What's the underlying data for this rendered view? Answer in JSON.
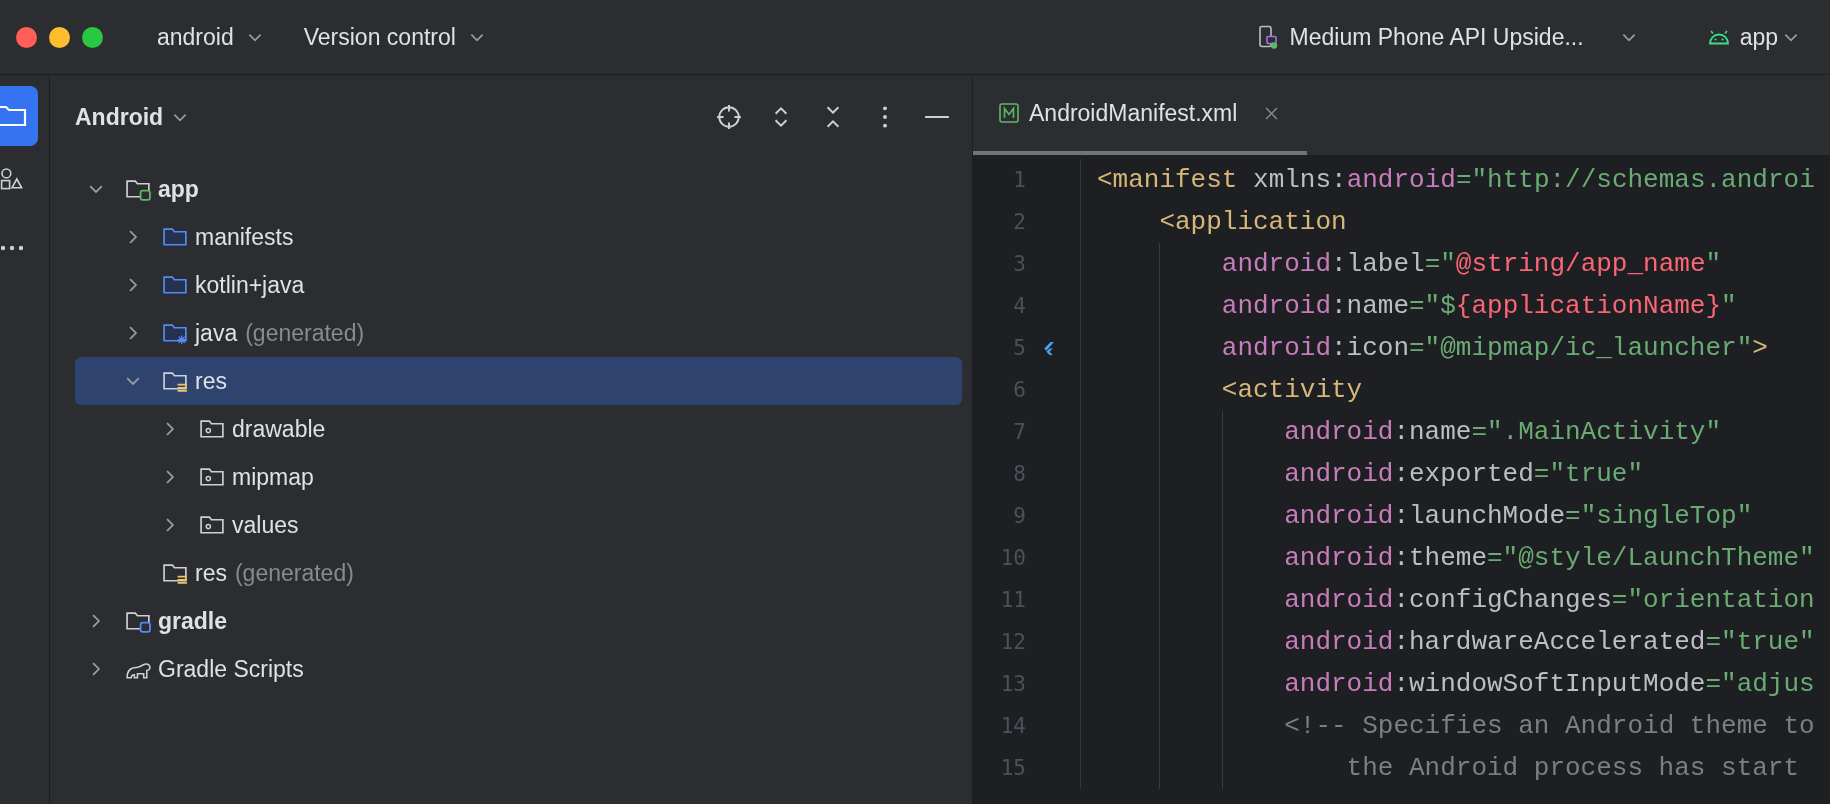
{
  "title_bar": {
    "project": "android",
    "vcs": "Version control",
    "device": "Medium Phone API Upside...",
    "run_config": "app"
  },
  "project_panel": {
    "title": "Android",
    "tree": [
      {
        "label": "app",
        "kind": "module",
        "expanded": true,
        "selected": false,
        "children": [
          {
            "label": "manifests",
            "kind": "folder",
            "expanded": false,
            "selected": false
          },
          {
            "label": "kotlin+java",
            "kind": "folder",
            "expanded": false,
            "selected": false
          },
          {
            "label": "java",
            "note": "(generated)",
            "kind": "generated",
            "expanded": false,
            "selected": false
          },
          {
            "label": "res",
            "kind": "res",
            "expanded": true,
            "selected": true,
            "children": [
              {
                "label": "drawable",
                "kind": "resdir",
                "expanded": false,
                "selected": false
              },
              {
                "label": "mipmap",
                "kind": "resdir",
                "expanded": false,
                "selected": false
              },
              {
                "label": "values",
                "kind": "resdir",
                "expanded": false,
                "selected": false
              }
            ]
          },
          {
            "label": "res",
            "note": "(generated)",
            "kind": "res",
            "selected": false
          }
        ]
      },
      {
        "label": "gradle",
        "kind": "gradle-module",
        "expanded": false,
        "selected": false
      },
      {
        "label": "Gradle Scripts",
        "kind": "scripts",
        "expanded": false,
        "selected": false
      }
    ]
  },
  "editor": {
    "tabs": [
      {
        "label": "AndroidManifest.xml",
        "selected": true
      }
    ],
    "lines": [
      {
        "number": "1",
        "marker": false,
        "tokens": [
          {
            "kind": "tag",
            "text": "<manifest "
          },
          {
            "kind": "plain",
            "text": "xmlns:"
          },
          {
            "kind": "ns",
            "text": "android"
          },
          {
            "kind": "str",
            "text": "=\"http://schemas.androi"
          }
        ],
        "children": [
          {
            "number": "2",
            "marker": false,
            "tokens": [
              {
                "kind": "tag",
                "text": "<application"
              }
            ],
            "children": [
              {
                "number": "3",
                "marker": false,
                "tokens": [
                  {
                    "kind": "ns",
                    "text": "android"
                  },
                  {
                    "kind": "plain",
                    "text": ":label"
                  },
                  {
                    "kind": "str",
                    "text": "=\""
                  },
                  {
                    "kind": "ref",
                    "text": "@string/app_name"
                  },
                  {
                    "kind": "str",
                    "text": "\""
                  }
                ]
              },
              {
                "number": "4",
                "marker": false,
                "tokens": [
                  {
                    "kind": "ns",
                    "text": "android"
                  },
                  {
                    "kind": "plain",
                    "text": ":name"
                  },
                  {
                    "kind": "str",
                    "text": "=\"$"
                  },
                  {
                    "kind": "ref",
                    "text": "{applicationName}"
                  },
                  {
                    "kind": "str",
                    "text": "\""
                  }
                ]
              },
              {
                "number": "5",
                "marker": true,
                "tokens": [
                  {
                    "kind": "ns",
                    "text": "android"
                  },
                  {
                    "kind": "plain",
                    "text": ":icon"
                  },
                  {
                    "kind": "str",
                    "text": "=\"@mipmap/ic_launcher\""
                  },
                  {
                    "kind": "tag",
                    "text": ">"
                  }
                ]
              },
              {
                "number": "6",
                "marker": false,
                "tokens": [
                  {
                    "kind": "tag",
                    "text": "<activity"
                  }
                ],
                "children": [
                  {
                    "number": "7",
                    "marker": false,
                    "tokens": [
                      {
                        "kind": "ns",
                        "text": "android"
                      },
                      {
                        "kind": "plain",
                        "text": ":name"
                      },
                      {
                        "kind": "str",
                        "text": "=\".MainActivity\""
                      }
                    ]
                  },
                  {
                    "number": "8",
                    "marker": false,
                    "tokens": [
                      {
                        "kind": "ns",
                        "text": "android"
                      },
                      {
                        "kind": "plain",
                        "text": ":exported"
                      },
                      {
                        "kind": "str",
                        "text": "=\"true\""
                      }
                    ]
                  },
                  {
                    "number": "9",
                    "marker": false,
                    "tokens": [
                      {
                        "kind": "ns",
                        "text": "android"
                      },
                      {
                        "kind": "plain",
                        "text": ":launchMode"
                      },
                      {
                        "kind": "str",
                        "text": "=\"singleTop\""
                      }
                    ]
                  },
                  {
                    "number": "10",
                    "marker": false,
                    "tokens": [
                      {
                        "kind": "ns",
                        "text": "android"
                      },
                      {
                        "kind": "plain",
                        "text": ":theme"
                      },
                      {
                        "kind": "str",
                        "text": "=\"@style/LaunchTheme\""
                      }
                    ]
                  },
                  {
                    "number": "11",
                    "marker": false,
                    "tokens": [
                      {
                        "kind": "ns",
                        "text": "android"
                      },
                      {
                        "kind": "plain",
                        "text": ":configChanges"
                      },
                      {
                        "kind": "str",
                        "text": "=\"orientation"
                      }
                    ]
                  },
                  {
                    "number": "12",
                    "marker": false,
                    "tokens": [
                      {
                        "kind": "ns",
                        "text": "android"
                      },
                      {
                        "kind": "plain",
                        "text": ":hardwareAccelerated"
                      },
                      {
                        "kind": "str",
                        "text": "=\"true\""
                      }
                    ]
                  },
                  {
                    "number": "13",
                    "marker": false,
                    "tokens": [
                      {
                        "kind": "ns",
                        "text": "android"
                      },
                      {
                        "kind": "plain",
                        "text": ":windowSoftInputMode"
                      },
                      {
                        "kind": "str",
                        "text": "=\"adjus"
                      }
                    ]
                  },
                  {
                    "number": "14",
                    "marker": false,
                    "tokens": [
                      {
                        "kind": "comment",
                        "text": "<!-- Specifies an Android theme to"
                      }
                    ],
                    "children": [
                      {
                        "number": "15",
                        "marker": false,
                        "tokens": [
                          {
                            "kind": "comment",
                            "text": "the Android process has start"
                          }
                        ]
                      }
                    ]
                  }
                ]
              }
            ]
          }
        ]
      }
    ]
  }
}
